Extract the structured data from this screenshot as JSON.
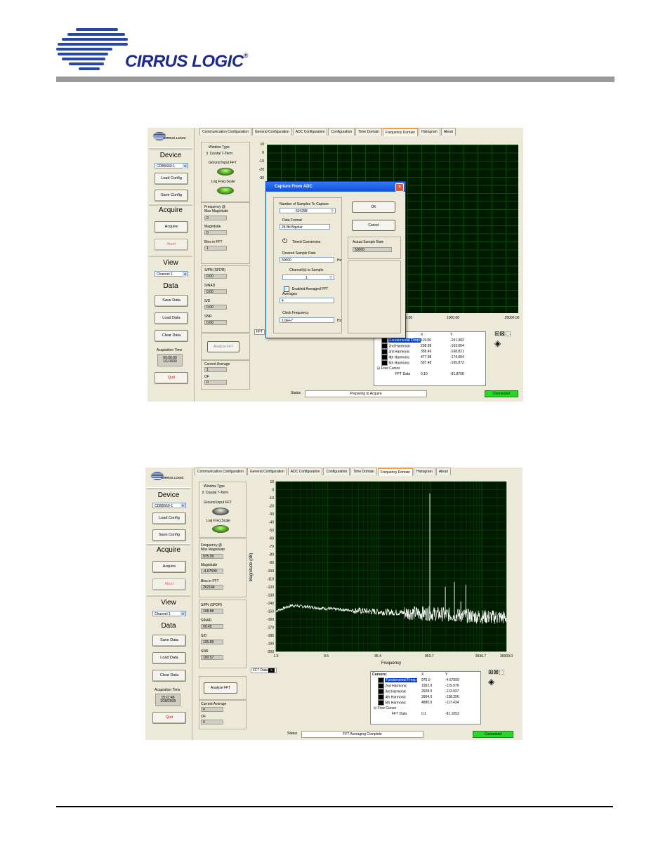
{
  "brand": {
    "name": "CIRRUS LOGIC",
    "trademark": "®"
  },
  "screens": [
    {
      "left_panel": {
        "logo": "CIRRUS LOGIC",
        "device_title": "Device",
        "device_select": "CDB5560-1",
        "load_config": "Load Config",
        "save_config": "Save Config",
        "acquire_title": "Acquire",
        "acquire_btn": "Acquire",
        "abort_btn": "Abort",
        "view_title": "View",
        "view_select": "Channel 1",
        "data_title": "Data",
        "save_data": "Save Data",
        "load_data": "Load Data",
        "clear_data": "Clear Data",
        "acq_time_label": "Acquisition Time",
        "acq_time_1": "00:00:00",
        "acq_time_2": "1/1/1600",
        "quit": "Quit"
      },
      "tabs": [
        "Communication Configuration",
        "General Configuration",
        "ADC Configuration",
        "Configuration",
        "Time Domain",
        "Frequency Domain",
        "Histogram",
        "About"
      ],
      "active_tab": "Frequency Domain",
      "settings": {
        "window_type_label": "Window Type",
        "window_type": "Crystal 7-Term",
        "ground_input": "Ground Input FFT",
        "log_freq": "Log Freq Scale",
        "freq_max_label_1": "Frequency @",
        "freq_max_label_2": "Max Magnitude",
        "freq_max": "0",
        "magnitude_label": "Magnitude",
        "magnitude": "0",
        "bins_label": "Bins in FFT",
        "bins": "1",
        "spfdr_label": "S/PN (SFDR)",
        "spfdr": "0.00",
        "sinad_label": "SINAD",
        "sinad": "0.00",
        "sd_label": "S/D",
        "sd": "0.00",
        "snr_label": "SNR",
        "snr": "0.00",
        "analyze_fft": "Analyze FFT",
        "cur_avg_label": "Current Average",
        "cur_avg": "1",
        "of_label": "OF",
        "of": "0"
      },
      "plot": {
        "yticks": [
          "10",
          "0",
          "-10",
          "-20",
          "-30"
        ],
        "xticks": [
          "00.00",
          "1000.00",
          "25000.00"
        ],
        "fft_tab": "FFT"
      },
      "cursors": {
        "header_x": "X",
        "header_y": "Y",
        "rows": [
          {
            "name": "Fundamental Frequ",
            "x": "119.50",
            "y": "-151.902"
          },
          {
            "name": "2nd Harmonic",
            "x": "238.99",
            "y": "-163.004"
          },
          {
            "name": "3rd Harmonic",
            "x": "358.49",
            "y": "-168.821"
          },
          {
            "name": "4th Harmonic",
            "x": "477.98",
            "y": "-174.004"
          },
          {
            "name": "5th Harmonic",
            "x": "597.48",
            "y": "-165.872"
          }
        ],
        "free_cursor": "Free Cursor",
        "fft_data": "FFT Data",
        "fft_x": "0.10",
        "fft_y": "-81.8708"
      },
      "status": {
        "label": "Status",
        "text": "Preparing to Acquire",
        "connection": "Connected"
      },
      "dialog": {
        "title": "Capture From ADC",
        "samples_label": "Number of Samples To Capture",
        "samples": "524288",
        "format_label": "Data Format",
        "format": "24 Bit Bipolar",
        "timed": "Timed Conversion",
        "rate_label": "Desired Sample Rate",
        "rate": "50000",
        "rate_unit": "Hz",
        "channels_label": "Channel(s) to Sample",
        "channels": "1",
        "avg_fft": "Enabled Averaged FFT",
        "averages_label": "Averages",
        "averages": "4",
        "clock_label": "Clock Frequency",
        "clock": "1.6E+7",
        "clock_unit": "Hz",
        "ok": "OK",
        "cancel": "Cancel",
        "actual_label": "Actual Sample Rate",
        "actual": "50000"
      }
    },
    {
      "left_panel": {
        "logo": "CIRRUS LOGIC",
        "device_title": "Device",
        "device_select": "CDB5560-1",
        "load_config": "Load Config",
        "save_config": "Save Config",
        "acquire_title": "Acquire",
        "acquire_btn": "Acquire",
        "abort_btn": "Abort",
        "view_title": "View",
        "view_select": "Channel 1",
        "data_title": "Data",
        "save_data": "Save Data",
        "load_data": "Load Data",
        "clear_data": "Clear Data",
        "acq_time_label": "Acquisition Time",
        "acq_time_1": "15:11:48",
        "acq_time_2": "1/28/2008",
        "quit": "Quit"
      },
      "tabs": [
        "Communication Configuration",
        "General Configuration",
        "ADC Configuration",
        "Configuration",
        "Time Domain",
        "Frequency Domain",
        "Histogram",
        "About"
      ],
      "active_tab": "Frequency Domain",
      "settings": {
        "window_type_label": "Window Type",
        "window_type": "Crystal 7-Term",
        "ground_input": "Ground Input FFT",
        "log_freq": "Log Freq Scale",
        "freq_max_label_1": "Frequency @",
        "freq_max_label_2": "Max Magnitude",
        "freq_max": "975.99",
        "magnitude_label": "Magnitude",
        "magnitude": "-4.67599",
        "bins_label": "Bins in FFT",
        "bins": "262144",
        "spfdr_label": "S/PN (SFDR)",
        "spfdr": "108.88",
        "sinad_label": "SINAD",
        "sinad": "99.45",
        "sd_label": "S/D",
        "sd": "105.89",
        "snr_label": "SNR",
        "snr": "100.57",
        "analyze_fft": "Analyze FFT",
        "cur_avg_label": "Current Average",
        "cur_avg": "4",
        "of_label": "OF",
        "of": "4"
      },
      "plot": {
        "ylabel": "Magnitude (dB)",
        "xlabel": "Frequency",
        "yticks": [
          "10",
          "0",
          "-10",
          "-20",
          "-30",
          "-40",
          "-50",
          "-60",
          "-70",
          "-80",
          "-90",
          "-100",
          "-110",
          "-120",
          "-130",
          "-140",
          "-150",
          "-160",
          "-170",
          "-180",
          "-190",
          "-200"
        ],
        "xticks": [
          "1.0",
          "9.5",
          "95.4",
          "953.7",
          "9536.7",
          "30000.0"
        ],
        "fft_tab": "FFT Data"
      },
      "cursors": {
        "header_name": "Cursors:",
        "header_x": "X",
        "header_y": "Y",
        "rows": [
          {
            "name": "Fundamental Frequ",
            "x": "976.0",
            "y": "-4.67599"
          },
          {
            "name": "2nd Harmonic",
            "x": "1952.0",
            "y": "-119.976"
          },
          {
            "name": "3rd Harmonic",
            "x": "2928.0",
            "y": "-113.937"
          },
          {
            "name": "4th Harmonic",
            "x": "3904.0",
            "y": "-138.256"
          },
          {
            "name": "5th Harmonic",
            "x": "4880.0",
            "y": "-117.434"
          }
        ],
        "free_cursor": "Free Cursor",
        "fft_data": "FFT Data",
        "fft_x": "0.1",
        "fft_y": "-81.1052"
      },
      "status": {
        "label": "Status",
        "text": "FFT Averaging Complete",
        "connection": "Connected"
      }
    }
  ],
  "chart_data": {
    "type": "line",
    "x_scale": "log",
    "xlim": [
      1,
      30000
    ],
    "ylim": [
      -200,
      10
    ],
    "xlabel": "Frequency",
    "ylabel": "Magnitude (dB)",
    "grid": true,
    "peaks": [
      {
        "x": 976.0,
        "y": -4.67599
      },
      {
        "x": 1952.0,
        "y": -119.976
      },
      {
        "x": 2928.0,
        "y": -113.937
      },
      {
        "x": 3904.0,
        "y": -138.256
      },
      {
        "x": 4880.0,
        "y": -117.434
      }
    ],
    "noise_floor": [
      {
        "x": 1.0,
        "y": -150
      },
      {
        "x": 2.0,
        "y": -143
      },
      {
        "x": 9.5,
        "y": -147
      },
      {
        "x": 95.4,
        "y": -151
      },
      {
        "x": 953.7,
        "y": -153
      },
      {
        "x": 9536.7,
        "y": -157
      },
      {
        "x": 30000.0,
        "y": -158
      }
    ],
    "colors": {
      "background": "#001a00",
      "grid": "#0d4a0d",
      "trace": "#ffffff",
      "marker": "#ff4040"
    }
  }
}
